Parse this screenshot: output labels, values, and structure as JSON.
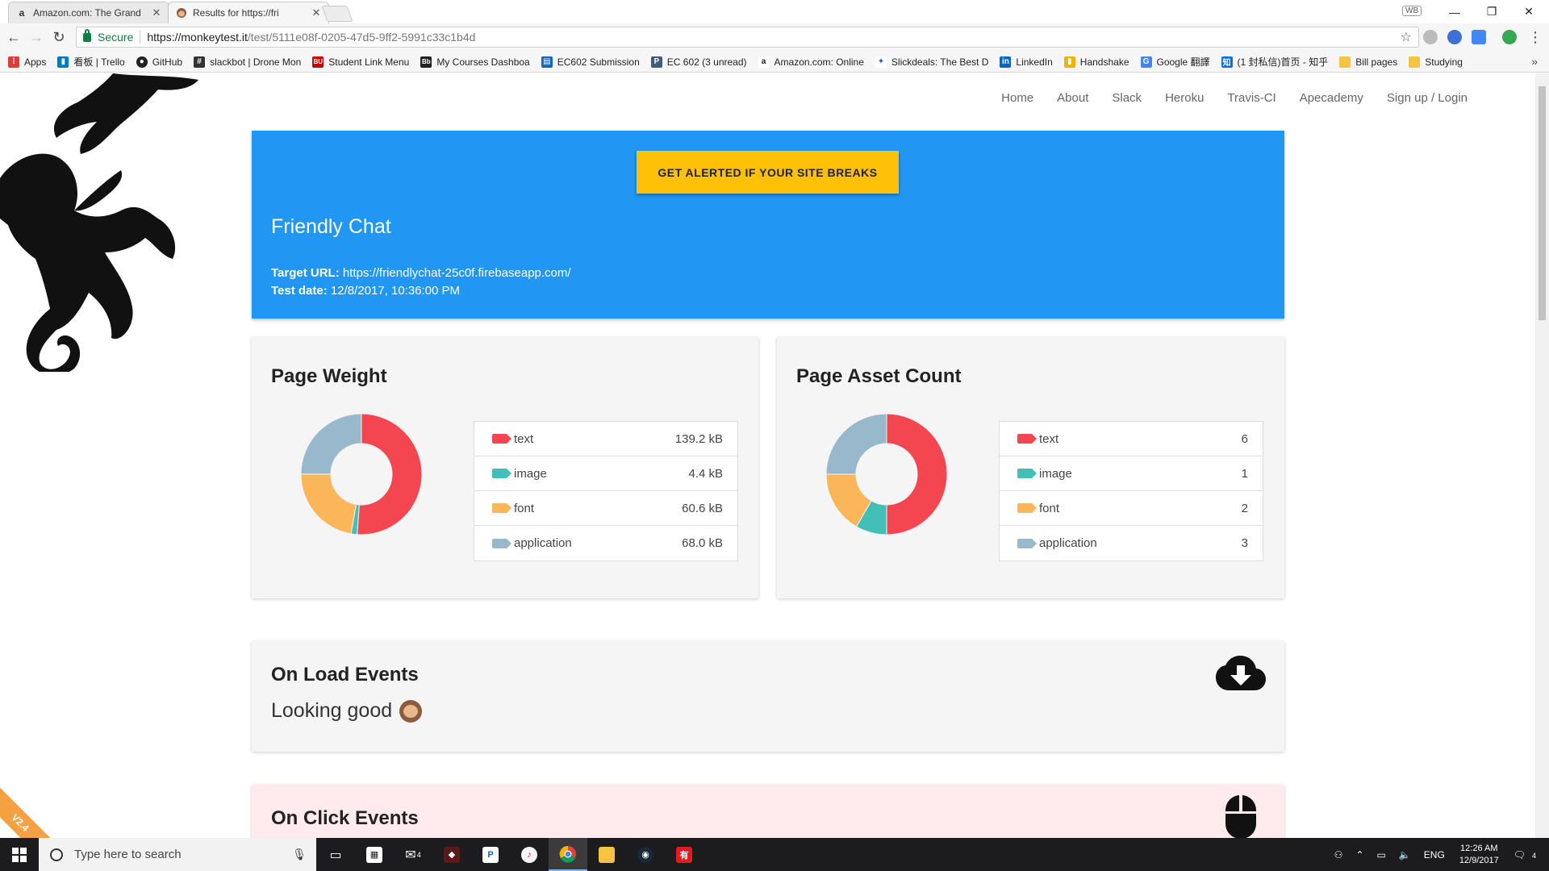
{
  "browser": {
    "tabs": [
      {
        "title": "Amazon.com: The Grand",
        "favicon": "a",
        "active": false
      },
      {
        "title": "Results for https://fri",
        "favicon": "monkey",
        "active": true
      }
    ],
    "secure_label": "Secure",
    "url_host": "https://monkeytest.it",
    "url_path": "/test/5111e08f-0205-47d5-9ff2-5991c33c1b4d",
    "incognito_badge": "WB",
    "bookmarks": [
      {
        "label": "Apps",
        "icon": "apps-grid-icon",
        "color": "#e53935"
      },
      {
        "label": "看板 | Trello",
        "icon": "trello-icon",
        "color": "#0079bf"
      },
      {
        "label": "GitHub",
        "icon": "github-icon",
        "color": "#222222"
      },
      {
        "label": "slackbot | Drone Mon",
        "icon": "hash-icon",
        "color": "#333333"
      },
      {
        "label": "Student Link Menu",
        "icon": "bu-icon",
        "color": "#cc0000"
      },
      {
        "label": "My Courses Dashboa",
        "icon": "bb-icon",
        "color": "#222222"
      },
      {
        "label": "EC602 Submission",
        "icon": "doc-icon",
        "color": "#1565c0"
      },
      {
        "label": "EC 602 (3 unread)",
        "icon": "piazza-icon",
        "color": "#3e5a7e"
      },
      {
        "label": "Amazon.com: Online",
        "icon": "amazon-icon",
        "color": "#222222"
      },
      {
        "label": "Slickdeals: The Best D",
        "icon": "slickdeals-icon",
        "color": "#1565c0"
      },
      {
        "label": "LinkedIn",
        "icon": "linkedin-icon",
        "color": "#0a66c2"
      },
      {
        "label": "Handshake",
        "icon": "handshake-icon",
        "color": "#f0b400"
      },
      {
        "label": "Google 翻譯",
        "icon": "translate-icon",
        "color": "#4285f4"
      },
      {
        "label": "(1 封私信)首页 - 知乎",
        "icon": "zhihu-icon",
        "color": "#0e6ee0"
      },
      {
        "label": "Bill pages",
        "icon": "folder-icon",
        "color": "#f6c343"
      },
      {
        "label": "Studying",
        "icon": "folder-icon",
        "color": "#f6c343"
      }
    ]
  },
  "site": {
    "nav": [
      "Home",
      "About",
      "Slack",
      "Heroku",
      "Travis-CI",
      "Apecademy",
      "Sign up / Login"
    ],
    "version": "V2.4",
    "cta_label": "GET ALERTED IF YOUR SITE BREAKS",
    "hero": {
      "title": "Friendly Chat",
      "target_label": "Target URL:",
      "target_url": "https://friendlychat-25c0f.firebaseapp.com/",
      "date_label": "Test date:",
      "date_value": "12/8/2017, 10:36:00 PM"
    },
    "colors": {
      "text": "#f44650",
      "image": "#42c0b8",
      "font": "#fbb65a",
      "application": "#98b9cc",
      "hero_bg": "#2196f3",
      "cta_bg": "#ffc107"
    },
    "page_weight": {
      "title": "Page Weight",
      "rows": [
        {
          "label": "text",
          "value": "139.2 kB"
        },
        {
          "label": "image",
          "value": "4.4 kB"
        },
        {
          "label": "font",
          "value": "60.6 kB"
        },
        {
          "label": "application",
          "value": "68.0 kB"
        }
      ],
      "amounts": [
        139.2,
        4.4,
        60.6,
        68.0
      ]
    },
    "asset_count": {
      "title": "Page Asset Count",
      "rows": [
        {
          "label": "text",
          "value": "6"
        },
        {
          "label": "image",
          "value": "1"
        },
        {
          "label": "font",
          "value": "2"
        },
        {
          "label": "application",
          "value": "3"
        }
      ],
      "amounts": [
        6,
        1,
        2,
        3
      ]
    },
    "on_load": {
      "title": "On Load Events",
      "status": "Looking good",
      "icon": "cloud-download-icon"
    },
    "on_click": {
      "title": "On Click Events",
      "icon": "mouse-icon"
    }
  },
  "taskbar": {
    "search_placeholder": "Type here to search",
    "mail_badge": "4",
    "lang": "ENG",
    "time": "12:26 AM",
    "date": "12/9/2017",
    "notification_count": "4"
  }
}
